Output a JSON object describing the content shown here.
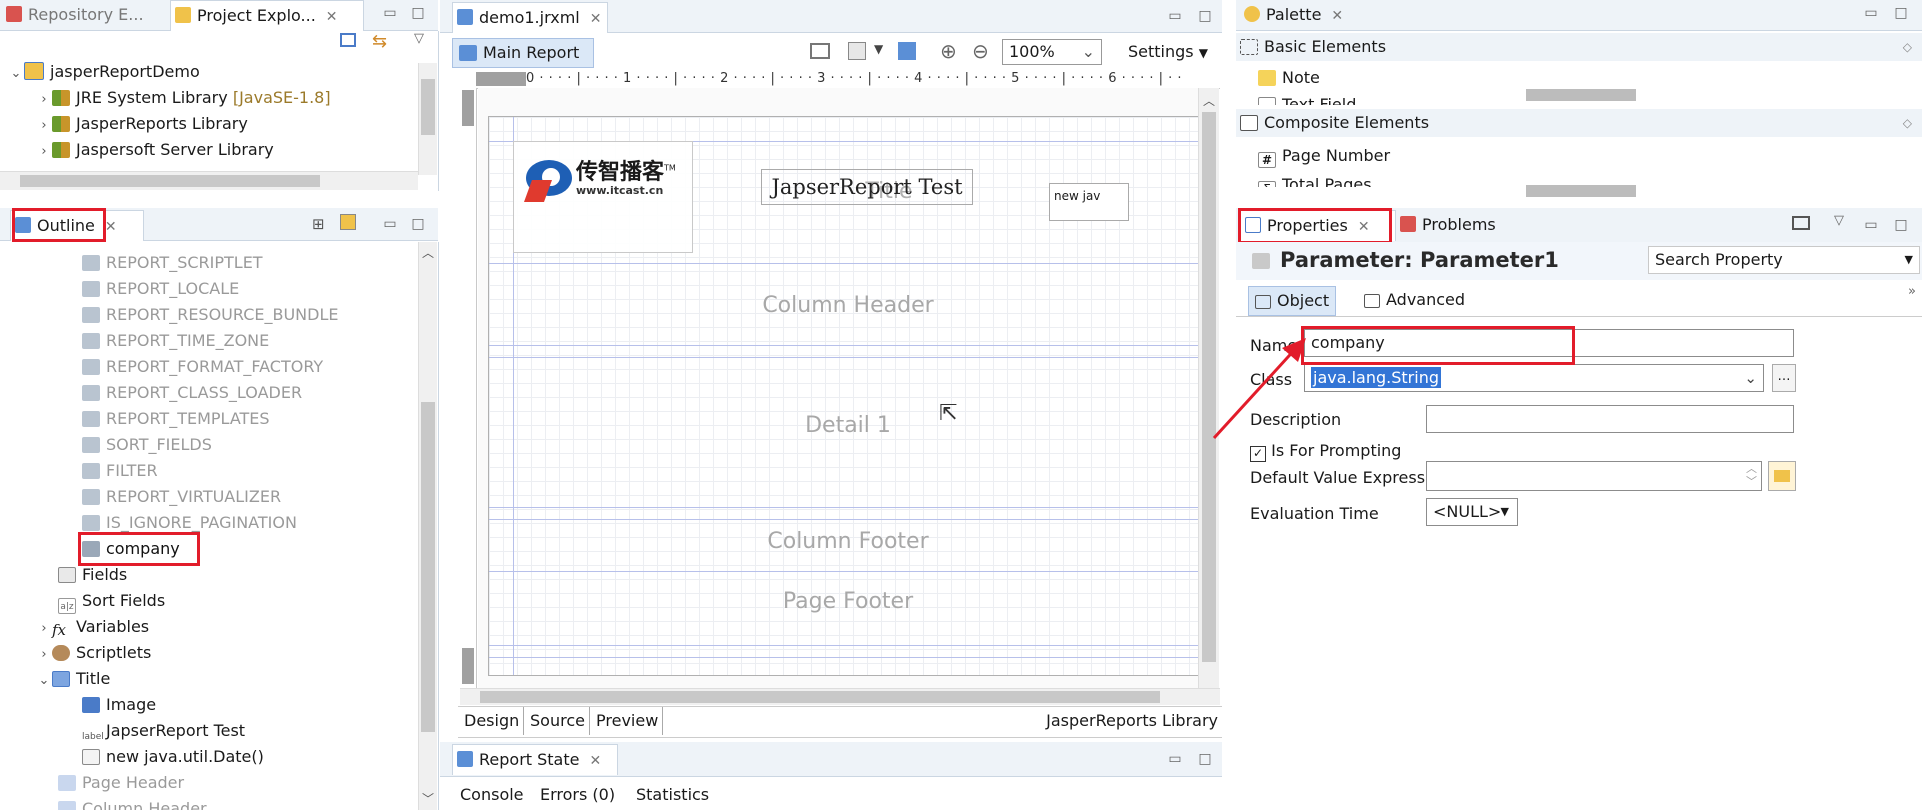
{
  "left_top_tabs": {
    "repo": "Repository E...",
    "project": "Project Explo...",
    "close": "✕"
  },
  "project_tree": [
    {
      "label": "jasperReportDemo",
      "extra": ""
    },
    {
      "label": "JRE System Library",
      "extra": "[JavaSE-1.8]"
    },
    {
      "label": "JasperReports Library",
      "extra": ""
    },
    {
      "label": "Jaspersoft Server Library",
      "extra": ""
    }
  ],
  "outline": {
    "tab": "Outline",
    "items": [
      "REPORT_SCRIPTLET",
      "REPORT_LOCALE",
      "REPORT_RESOURCE_BUNDLE",
      "REPORT_TIME_ZONE",
      "REPORT_FORMAT_FACTORY",
      "REPORT_CLASS_LOADER",
      "REPORT_TEMPLATES",
      "SORT_FIELDS",
      "FILTER",
      "REPORT_VIRTUALIZER",
      "IS_IGNORE_PAGINATION"
    ],
    "selected": "company",
    "sections": [
      {
        "label": "Fields"
      },
      {
        "label": "Sort Fields"
      },
      {
        "label": "Variables"
      },
      {
        "label": "Scriptlets"
      },
      {
        "label": "Title"
      }
    ],
    "title_children": [
      "Image",
      "JapserReport Test",
      "new java.util.Date()"
    ],
    "after": [
      "Page Header",
      "Column Header"
    ],
    "icon_labels": {
      "sort": "a|z",
      "fx": "fx",
      "label": "label"
    }
  },
  "editor": {
    "tab": "demo1.jrxml",
    "main_report": "Main Report",
    "zoom": "100%",
    "settings": "Settings",
    "ruler": "0 · · · · | · · · · 1 · · · · | · · · · 2 · · · · | · · · · 3 · · · · | · · · · 4 · · · · | · · · · 5 · · · · | · · · · 6 · · · · | · ·",
    "logo_cn": "传智播客",
    "logo_tm": "TM",
    "logo_url": "www.itcast.cn",
    "title_text": "JapserReport Test",
    "title_band": "Title",
    "date_field": "new jav",
    "bands": [
      "Column Header",
      "Detail 1",
      "Column Footer",
      "Page Footer"
    ],
    "bottom_tabs": [
      "Design",
      "Source",
      "Preview"
    ],
    "library": "JasperReports Library"
  },
  "report_state": {
    "tab": "Report State",
    "items": [
      "Console",
      "Errors (0)",
      "Statistics"
    ]
  },
  "palette": {
    "tab": "Palette",
    "basic": "Basic Elements",
    "basic_items": [
      "Note",
      "Text Field"
    ],
    "composite": "Composite Elements",
    "composite_items": [
      "Page Number",
      "Total Pages"
    ],
    "composite_icons": [
      "#",
      "Σ"
    ]
  },
  "properties": {
    "tab": "Properties",
    "problems_tab": "Problems",
    "heading": "Parameter: Parameter1",
    "search": "Search Property",
    "subtabs": [
      "Object",
      "Advanced"
    ],
    "fields": {
      "name_label": "Name",
      "name_value": "company",
      "class_label": "Class",
      "class_value": "java.lang.String",
      "desc_label": "Description",
      "prompt_label": "Is For Prompting",
      "default_label": "Default Value Expression",
      "eval_label": "Evaluation Time",
      "eval_value": "<NULL>"
    }
  },
  "colors": {
    "highlight": "#e21c2a",
    "selection": "#3375d6",
    "band_line": "#b7c0ea"
  }
}
